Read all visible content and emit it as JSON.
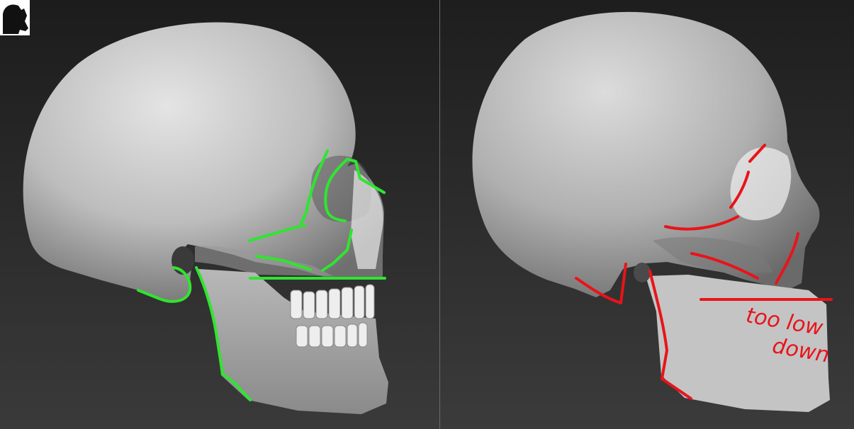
{
  "left_view": {
    "annotation_color": "#2fe52f"
  },
  "right_view": {
    "annotation_color": "#e8141a",
    "note": {
      "line1": "too low",
      "line2": "down"
    }
  },
  "colors": {
    "background": "#242424",
    "bone": "#c8c8c8",
    "divider": "#6a6a6a"
  }
}
